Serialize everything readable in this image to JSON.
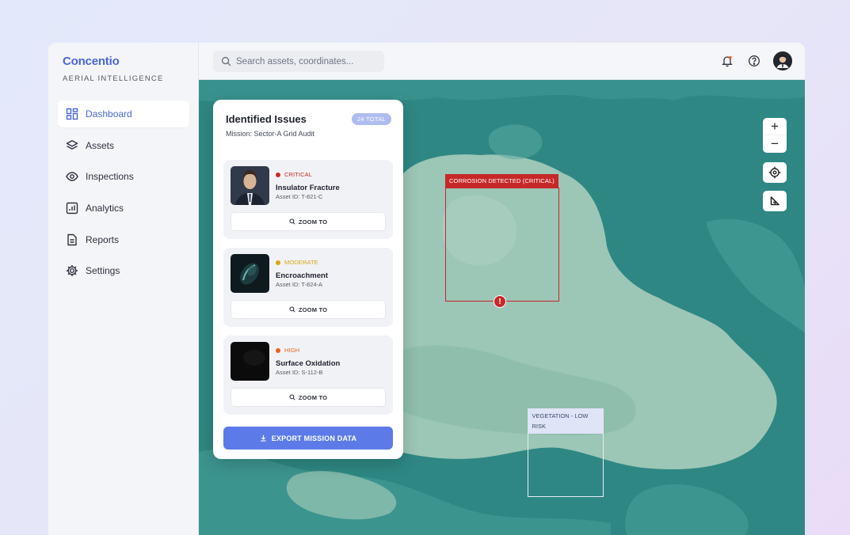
{
  "brand": {
    "name": "Concentio",
    "tagline": "AERIAL INTELLIGENCE"
  },
  "nav": [
    {
      "label": "Dashboard",
      "icon": "dashboard-icon",
      "active": true
    },
    {
      "label": "Assets",
      "icon": "layers-icon",
      "active": false
    },
    {
      "label": "Inspections",
      "icon": "eye-icon",
      "active": false
    },
    {
      "label": "Analytics",
      "icon": "chart-icon",
      "active": false
    },
    {
      "label": "Reports",
      "icon": "document-icon",
      "active": false
    },
    {
      "label": "Settings",
      "icon": "gear-icon",
      "active": false
    }
  ],
  "search": {
    "placeholder": "Search assets, coordinates..."
  },
  "panel": {
    "title": "Identified Issues",
    "badge": "24 TOTAL",
    "subtitle": "Mission: Sector-A Grid Audit",
    "issues": [
      {
        "severity": "CRITICAL",
        "severity_color": "#c62828",
        "title": "Insulator Fracture",
        "asset": "Asset ID: T-821-C",
        "action": "ZOOM TO"
      },
      {
        "severity": "MODERATE",
        "severity_color": "#d9a514",
        "title": "Encroachment",
        "asset": "Asset ID: T-824-A",
        "action": "ZOOM TO"
      },
      {
        "severity": "HIGH",
        "severity_color": "#e8621a",
        "title": "Surface Oxidation",
        "asset": "Asset ID: S-112-B",
        "action": "ZOOM TO"
      }
    ],
    "export_label": "EXPORT MISSION DATA"
  },
  "map": {
    "detections": [
      {
        "label": "CORROSION DETECTED (CRITICAL)",
        "color": "#c62828"
      },
      {
        "label": "VEGETATION - LOW RISK",
        "color": "#dfe4f6"
      }
    ],
    "controls": {
      "zoom_in": "+",
      "zoom_out": "−"
    }
  },
  "colors": {
    "accent": "#4a66d8",
    "map_water": "#2f8a86",
    "map_land": "#9cc6b6"
  }
}
